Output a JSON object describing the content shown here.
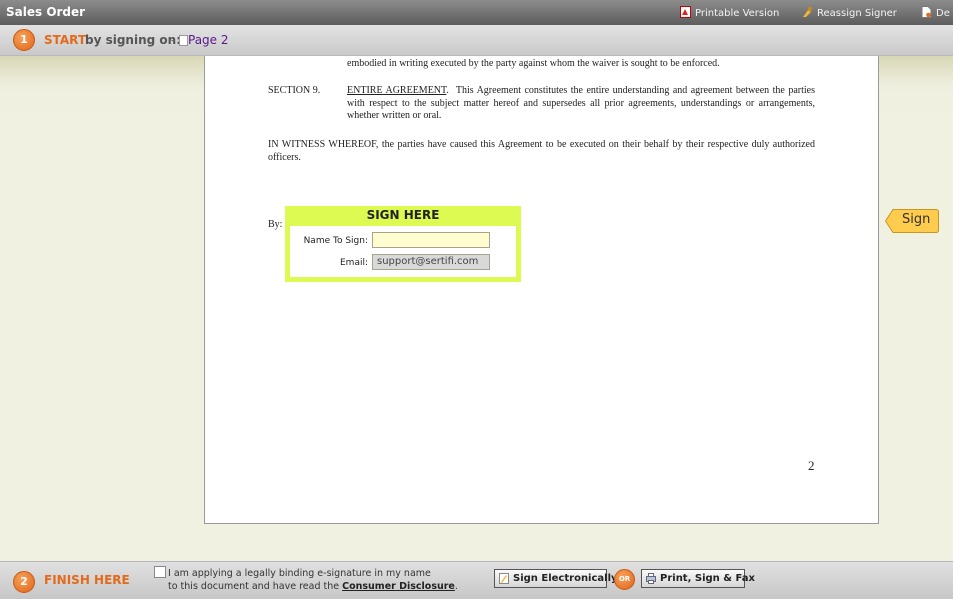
{
  "titlebar": {
    "title": "Sales Order",
    "actions": [
      {
        "label": "Printable Version",
        "icon": "pdf-icon"
      },
      {
        "label": "Reassign Signer",
        "icon": "reassign-icon"
      },
      {
        "label": "De",
        "icon": "document-icon"
      }
    ]
  },
  "step1": {
    "number": "1",
    "start": "START",
    "rest": "by signing on:",
    "dash": "-",
    "page_link": "Page 2"
  },
  "document": {
    "waiver_text": "embodied in writing executed by the party against whom the waiver is sought to be enforced.",
    "section_number": "SECTION 9.",
    "section_title": "ENTIRE AGREEMENT",
    "section_body": "This Agreement constitutes the entire understanding and agreement between the parties with respect to the subject matter hereof and supersedes all prior agreements, understandings or arrangements, whether written or oral.",
    "witness_text": "IN WITNESS WHEREOF, the parties have caused this Agreement to be executed on their behalf by their respective duly authorized officers.",
    "by_label": "By:",
    "page_number": "2"
  },
  "sign_box": {
    "header": "SIGN HERE",
    "name_label": "Name To Sign:",
    "name_value": "",
    "email_label": "Email:",
    "email_value": "support@sertifi.com"
  },
  "sign_tab": {
    "label": "Sign"
  },
  "footer": {
    "number": "2",
    "finish": "FINISH HERE",
    "agree_line1": "I am applying a legally binding e-signature in my name",
    "agree_line2_prefix": "to this document and have read the ",
    "agree_link": "Consumer Disclosure",
    "agree_suffix": ".",
    "sign_electronically": "Sign Electronically",
    "or": "OR",
    "print_sign_fax": "Print, Sign & Fax"
  },
  "colors": {
    "accent_orange": "#e36a1c",
    "sign_box_green": "#dcfa52",
    "sign_tab_yellow": "#ffcc4d"
  }
}
